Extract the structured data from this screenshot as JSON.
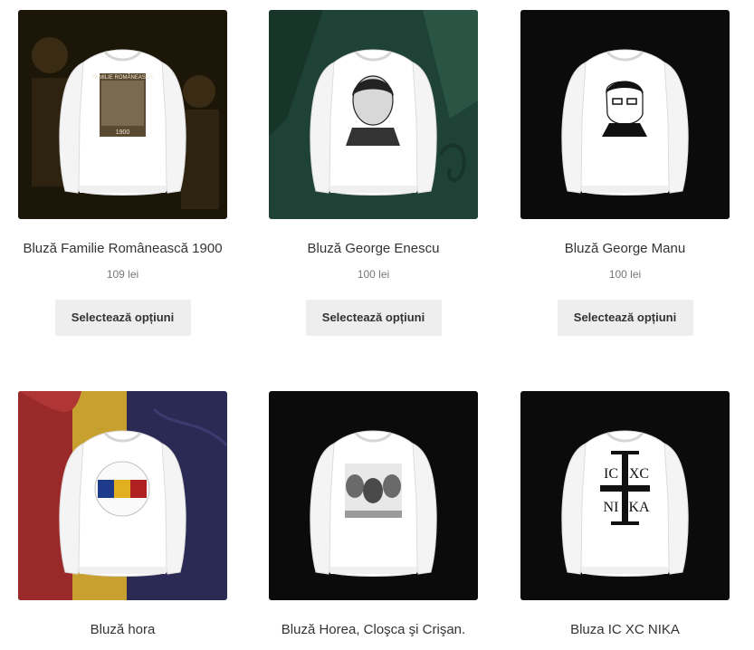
{
  "products": [
    {
      "title": "Bluză Familie Românească 1900",
      "price": "109 lei",
      "button": "Selectează opțiuni",
      "bg": "#1c1608",
      "print_title": "FAMILIE ROMÂNEASCĂ",
      "print_year": "1900"
    },
    {
      "title": "Bluză George Enescu",
      "price": "100 lei",
      "button": "Selectează opțiuni",
      "bg": "#1f4236"
    },
    {
      "title": "Bluză George Manu",
      "price": "100 lei",
      "button": "Selectează opțiuni",
      "bg": "#0b0b0b"
    },
    {
      "title": "Bluză hora",
      "price": "",
      "button": "",
      "bg": "#2a2a55"
    },
    {
      "title": "Bluză Horea, Cloşca şi Crişan.",
      "price": "",
      "button": "",
      "bg": "#0b0b0b"
    },
    {
      "title": "Bluza IC XC NIKA",
      "price": "",
      "button": "",
      "bg": "#0b0b0b",
      "print_tl": "IC",
      "print_tr": "XC",
      "print_bl": "NI",
      "print_br": "KA"
    }
  ]
}
